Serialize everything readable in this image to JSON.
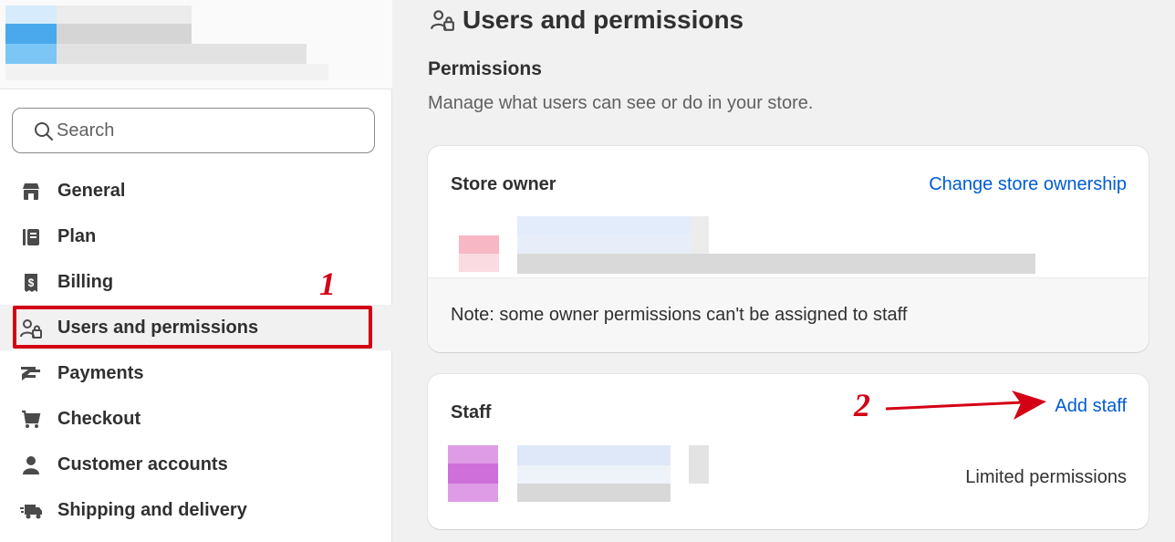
{
  "sidebar": {
    "search": {
      "placeholder": "Search"
    },
    "items": [
      {
        "label": "General",
        "icon": "store-icon"
      },
      {
        "label": "Plan",
        "icon": "plan-icon"
      },
      {
        "label": "Billing",
        "icon": "billing-icon"
      },
      {
        "label": "Users and permissions",
        "icon": "users-icon",
        "active": true
      },
      {
        "label": "Payments",
        "icon": "payments-icon"
      },
      {
        "label": "Checkout",
        "icon": "cart-icon"
      },
      {
        "label": "Customer accounts",
        "icon": "person-icon"
      },
      {
        "label": "Shipping and delivery",
        "icon": "truck-icon"
      }
    ]
  },
  "annotations": {
    "step1": "1",
    "step2": "2",
    "color": "#d40015"
  },
  "main": {
    "title": "Users and permissions",
    "section_title": "Permissions",
    "section_desc": "Manage what users can see or do in your store.",
    "owner_card": {
      "title": "Store owner",
      "link": "Change store ownership",
      "note": "Note: some owner permissions can't be assigned to staff"
    },
    "staff_card": {
      "title": "Staff",
      "link": "Add staff",
      "permission": "Limited permissions"
    }
  },
  "colors": {
    "link": "#005bd3",
    "text": "#303030",
    "muted": "#616161",
    "background": "#f1f1f1"
  }
}
